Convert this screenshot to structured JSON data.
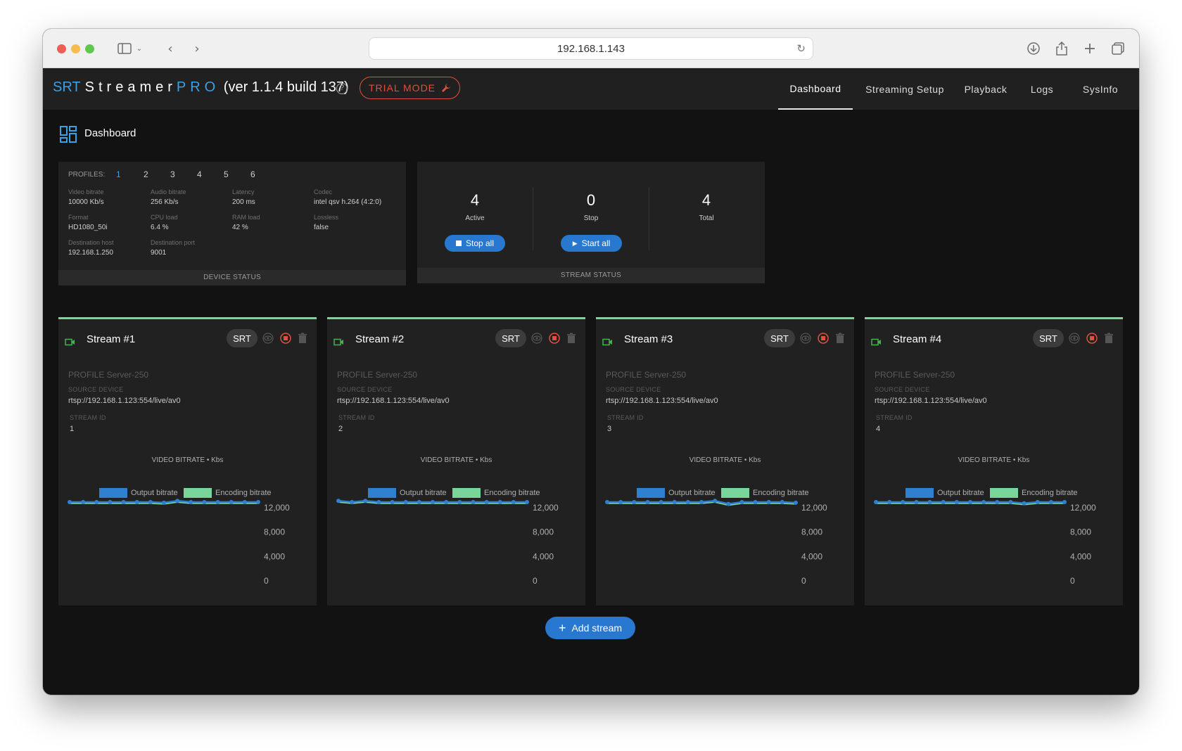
{
  "browser": {
    "url": "192.168.1.143"
  },
  "header": {
    "brand_srt": "SRT",
    "brand_streamer": "Streamer",
    "brand_pro": "PRO",
    "version": "(ver 1.1.4 build 137)",
    "trial_label": "TRIAL MODE",
    "nav": [
      "Dashboard",
      "Streaming Setup",
      "Playback",
      "Logs",
      "SysInfo"
    ],
    "active_nav": "Dashboard"
  },
  "page": {
    "title": "Dashboard"
  },
  "device_status": {
    "profiles_label": "PROFILES:",
    "profiles": [
      "1",
      "2",
      "3",
      "4",
      "5",
      "6"
    ],
    "active_profile": "1",
    "fields": [
      {
        "label": "Video bitrate",
        "value": "10000 Kb/s"
      },
      {
        "label": "Audio bitrate",
        "value": "256 Kb/s"
      },
      {
        "label": "Latency",
        "value": "200 ms"
      },
      {
        "label": "Codec",
        "value": "intel qsv h.264 (4:2:0)"
      },
      {
        "label": "Format",
        "value": "HD1080_50i"
      },
      {
        "label": "CPU load",
        "value": "6.4 %"
      },
      {
        "label": "RAM load",
        "value": "42 %"
      },
      {
        "label": "Lossless",
        "value": "false"
      },
      {
        "label": "Destination host",
        "value": "192.168.1.250"
      },
      {
        "label": "Destination port",
        "value": "9001"
      }
    ],
    "footer": "DEVICE STATUS"
  },
  "stream_status": {
    "active_count": "4",
    "active_label": "Active",
    "stop_count": "0",
    "stop_label": "Stop",
    "total_count": "4",
    "total_label": "Total",
    "stop_all_label": "Stop all",
    "start_all_label": "Start all",
    "footer": "STREAM STATUS"
  },
  "streams": [
    {
      "title": "Stream #1",
      "protocol": "SRT",
      "profile": "PROFILE Server-250",
      "source_label": "SOURCE DEVICE",
      "source": "rtsp://192.168.1.123:554/live/av0",
      "id_label": "STREAM ID",
      "id": "1"
    },
    {
      "title": "Stream #2",
      "protocol": "SRT",
      "profile": "PROFILE Server-250",
      "source_label": "SOURCE DEVICE",
      "source": "rtsp://192.168.1.123:554/live/av0",
      "id_label": "STREAM ID",
      "id": "2"
    },
    {
      "title": "Stream #3",
      "protocol": "SRT",
      "profile": "PROFILE Server-250",
      "source_label": "SOURCE DEVICE",
      "source": "rtsp://192.168.1.123:554/live/av0",
      "id_label": "STREAM ID",
      "id": "3"
    },
    {
      "title": "Stream #4",
      "protocol": "SRT",
      "profile": "PROFILE Server-250",
      "source_label": "SOURCE DEVICE",
      "source": "rtsp://192.168.1.123:554/live/av0",
      "id_label": "STREAM ID",
      "id": "4"
    }
  ],
  "chart_labels": {
    "title": "VIDEO BITRATE • Kbs",
    "legend_output": "Output bitrate",
    "legend_encoding": "Encoding bitrate"
  },
  "chart_data": [
    {
      "type": "line",
      "ylim": [
        0,
        12000
      ],
      "yticks": [
        "12,000",
        "8,000",
        "4,000",
        "0"
      ],
      "series": [
        {
          "name": "Output bitrate",
          "values": [
            12000,
            12000,
            12000,
            12000,
            12000,
            12000,
            12000,
            11900,
            12200,
            12000,
            12000,
            12000,
            12000,
            12000,
            12000
          ]
        },
        {
          "name": "Encoding bitrate",
          "values": [
            12000,
            12000,
            12000,
            12000,
            12000,
            12000,
            12000,
            11900,
            12200,
            12000,
            12000,
            12000,
            12000,
            12000,
            12000
          ]
        }
      ]
    },
    {
      "type": "line",
      "ylim": [
        0,
        12000
      ],
      "yticks": [
        "12,000",
        "8,000",
        "4,000",
        "0"
      ],
      "series": [
        {
          "name": "Output bitrate",
          "values": [
            12200,
            12000,
            12200,
            12000,
            12000,
            12000,
            12000,
            12000,
            12000,
            12000,
            12000,
            12000,
            12000,
            12000,
            12000
          ]
        },
        {
          "name": "Encoding bitrate",
          "values": [
            12200,
            12000,
            12200,
            12000,
            12000,
            12000,
            12000,
            12000,
            12000,
            12000,
            12000,
            12000,
            12000,
            12000,
            12000
          ]
        }
      ]
    },
    {
      "type": "line",
      "ylim": [
        0,
        12000
      ],
      "yticks": [
        "12,000",
        "8,000",
        "4,000",
        "0"
      ],
      "series": [
        {
          "name": "Output bitrate",
          "values": [
            12000,
            12000,
            12000,
            12000,
            12000,
            12000,
            12000,
            12000,
            12200,
            11700,
            12000,
            12000,
            12000,
            12000,
            11900
          ]
        },
        {
          "name": "Encoding bitrate",
          "values": [
            12000,
            12000,
            12000,
            12000,
            12000,
            12000,
            12000,
            12000,
            12200,
            11700,
            12000,
            12000,
            12000,
            12000,
            11900
          ]
        }
      ]
    },
    {
      "type": "line",
      "ylim": [
        0,
        12000
      ],
      "yticks": [
        "12,000",
        "8,000",
        "4,000",
        "0"
      ],
      "series": [
        {
          "name": "Output bitrate",
          "values": [
            12000,
            12000,
            12000,
            12000,
            12000,
            12000,
            12000,
            12000,
            12000,
            12000,
            12000,
            11800,
            12000,
            12000,
            12000
          ]
        },
        {
          "name": "Encoding bitrate",
          "values": [
            12000,
            12000,
            12000,
            12000,
            12000,
            12000,
            12000,
            12000,
            12000,
            12000,
            12000,
            11800,
            12000,
            12000,
            12000
          ]
        }
      ]
    }
  ],
  "add_stream_label": "Add stream",
  "colors": {
    "accent": "#2878d0",
    "brand_blue": "#3aa0e8",
    "trial_red": "#e0503b",
    "output_series": "#2f80d0",
    "encoding_series": "#7ad59b",
    "card_top": "#7ad59b"
  }
}
